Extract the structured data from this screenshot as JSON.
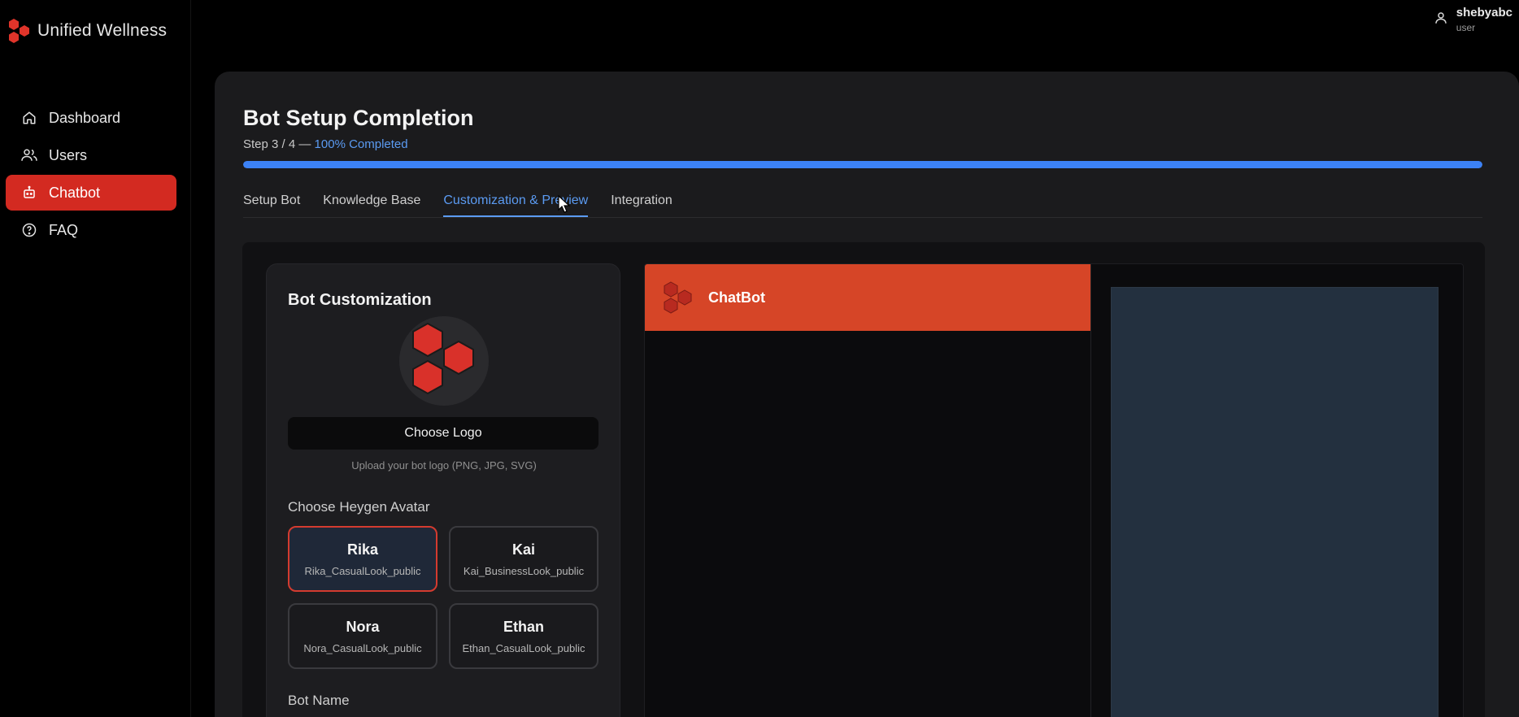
{
  "brand": {
    "name": "Unified Wellness"
  },
  "nav": [
    {
      "label": "Dashboard",
      "icon": "home-icon",
      "active": false
    },
    {
      "label": "Users",
      "icon": "users-icon",
      "active": false
    },
    {
      "label": "Chatbot",
      "icon": "bot-icon",
      "active": true
    },
    {
      "label": "FAQ",
      "icon": "help-icon",
      "active": false
    }
  ],
  "user": {
    "name": "shebyabc",
    "role": "user",
    "icon": "user-icon"
  },
  "page": {
    "title": "Bot Setup Completion",
    "step_text": "Step 3 / 4 — ",
    "completed_text": "100% Completed",
    "progress": 1.0
  },
  "tabs": [
    {
      "label": "Setup Bot",
      "active": false
    },
    {
      "label": "Knowledge Base",
      "active": false
    },
    {
      "label": "Customization & Preview",
      "active": true
    },
    {
      "label": "Integration",
      "active": false
    }
  ],
  "customization": {
    "title": "Bot Customization",
    "choose_logo_label": "Choose Logo",
    "upload_hint": "Upload your bot logo (PNG, JPG, SVG)",
    "avatar_label": "Choose Heygen Avatar",
    "avatars": [
      {
        "name": "Rika",
        "id": "Rika_CasualLook_public",
        "selected": true
      },
      {
        "name": "Kai",
        "id": "Kai_BusinessLook_public",
        "selected": false
      },
      {
        "name": "Nora",
        "id": "Nora_CasualLook_public",
        "selected": false
      },
      {
        "name": "Ethan",
        "id": "Ethan_CasualLook_public",
        "selected": false
      }
    ],
    "bot_name_label": "Bot Name"
  },
  "chat_preview": {
    "title": "ChatBot"
  },
  "colors": {
    "accent": "#d32a21",
    "header": "#d64527",
    "link": "#5b9bf2",
    "progress": "#3c82f6"
  }
}
